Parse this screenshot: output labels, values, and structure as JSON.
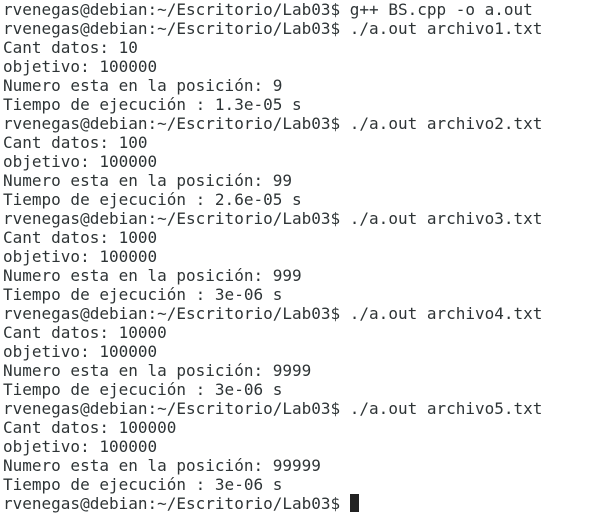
{
  "terminal": {
    "lines": [
      "rvenegas@debian:~/Escritorio/Lab03$ g++ BS.cpp -o a.out",
      "rvenegas@debian:~/Escritorio/Lab03$ ./a.out archivo1.txt",
      "Cant datos: 10",
      "objetivo: 100000",
      "Numero esta en la posición: 9",
      "Tiempo de ejecución : 1.3e-05 s",
      "rvenegas@debian:~/Escritorio/Lab03$ ./a.out archivo2.txt",
      "Cant datos: 100",
      "objetivo: 100000",
      "Numero esta en la posición: 99",
      "Tiempo de ejecución : 2.6e-05 s",
      "rvenegas@debian:~/Escritorio/Lab03$ ./a.out archivo3.txt",
      "Cant datos: 1000",
      "objetivo: 100000",
      "Numero esta en la posición: 999",
      "Tiempo de ejecución : 3e-06 s",
      "rvenegas@debian:~/Escritorio/Lab03$ ./a.out archivo4.txt",
      "Cant datos: 10000",
      "objetivo: 100000",
      "Numero esta en la posición: 9999",
      "Tiempo de ejecución : 3e-06 s",
      "rvenegas@debian:~/Escritorio/Lab03$ ./a.out archivo5.txt",
      "Cant datos: 100000",
      "objetivo: 100000",
      "Numero esta en la posición: 99999",
      "Tiempo de ejecución : 3e-06 s"
    ],
    "current_prompt": "rvenegas@debian:~/Escritorio/Lab03$ ",
    "colors": {
      "background": "#ffffff",
      "foreground": "#2e3436",
      "cursor": "#222222"
    }
  }
}
